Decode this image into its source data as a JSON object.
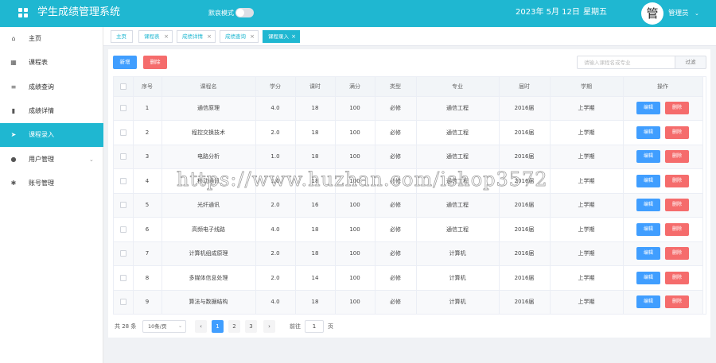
{
  "header": {
    "app_title": "学生成绩管理系统",
    "mode_label": "默哀模式",
    "date": "2023年 5月 12日",
    "weekday": "星期五",
    "avatar_char": "管",
    "user_name": "管理员",
    "accent_color": "#1fb7d1"
  },
  "sidebar": {
    "items": [
      {
        "label": "主页",
        "icon": "home-icon"
      },
      {
        "label": "课程表",
        "icon": "grid-icon"
      },
      {
        "label": "成绩查询",
        "icon": "list-icon"
      },
      {
        "label": "成绩详情",
        "icon": "bar-chart-icon"
      },
      {
        "label": "课程录入",
        "icon": "send-icon",
        "active": true
      },
      {
        "label": "用户管理",
        "icon": "user-icon",
        "expandable": true
      },
      {
        "label": "账号管理",
        "icon": "gear-icon"
      }
    ]
  },
  "tabs": [
    {
      "label": "主页",
      "closable": false
    },
    {
      "label": "课程表",
      "closable": true
    },
    {
      "label": "成绩详情",
      "closable": true
    },
    {
      "label": "成绩查询",
      "closable": true
    },
    {
      "label": "课程录入",
      "closable": true,
      "active": true
    }
  ],
  "toolbar": {
    "add_label": "新增",
    "delete_label": "删除",
    "search_placeholder": "请输入课程名或专业",
    "filter_label": "过滤"
  },
  "table": {
    "columns": [
      "序号",
      "课程名",
      "学分",
      "课时",
      "满分",
      "类型",
      "专业",
      "届时",
      "学期",
      "操作"
    ],
    "rows": [
      [
        "1",
        "通信原理",
        "4.0",
        "18",
        "100",
        "必修",
        "通信工程",
        "2016届",
        "上学期"
      ],
      [
        "2",
        "程控交换技术",
        "2.0",
        "18",
        "100",
        "必修",
        "通信工程",
        "2016届",
        "上学期"
      ],
      [
        "3",
        "电路分析",
        "1.0",
        "18",
        "100",
        "必修",
        "通信工程",
        "2016届",
        "上学期"
      ],
      [
        "4",
        "移动通讯",
        "1.0",
        "18",
        "100",
        "必修",
        "通信工程",
        "2016届",
        "上学期"
      ],
      [
        "5",
        "光纤通讯",
        "2.0",
        "16",
        "100",
        "必修",
        "通信工程",
        "2016届",
        "上学期"
      ],
      [
        "6",
        "高频电子线路",
        "4.0",
        "18",
        "100",
        "必修",
        "通信工程",
        "2016届",
        "上学期"
      ],
      [
        "7",
        "计算机组成原理",
        "2.0",
        "18",
        "100",
        "必修",
        "计算机",
        "2016届",
        "上学期"
      ],
      [
        "8",
        "多媒体信息处理",
        "2.0",
        "14",
        "100",
        "必修",
        "计算机",
        "2016届",
        "上学期"
      ],
      [
        "9",
        "算法与数据结构",
        "4.0",
        "18",
        "100",
        "必修",
        "计算机",
        "2016届",
        "上学期"
      ]
    ],
    "edit_label": "编辑",
    "delete_label": "删除"
  },
  "pagination": {
    "total": "共 28 条",
    "page_size": "10条/页",
    "pages": [
      "1",
      "2",
      "3"
    ],
    "current_page": "1",
    "goto_label": "前往",
    "goto_value": "1",
    "page_unit": "页",
    "prev": "‹",
    "next": "›"
  },
  "watermark": "https://www.huzhan.com/ishop3572"
}
